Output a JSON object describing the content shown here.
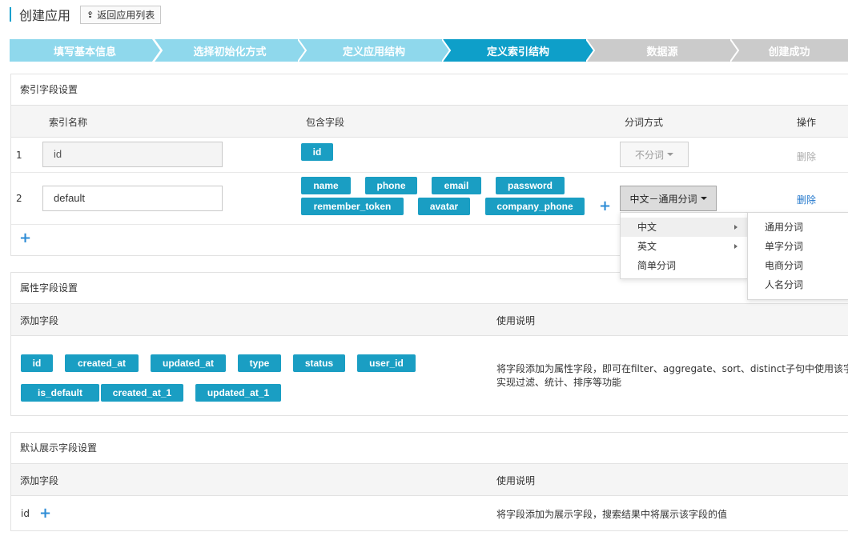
{
  "header": {
    "title": "创建应用",
    "back_label": "返回应用列表"
  },
  "steps": [
    "填写基本信息",
    "选择初始化方式",
    "定义应用结构",
    "定义索引结构",
    "数据源",
    "创建成功"
  ],
  "colors": {
    "step_done": "#8fd8ec",
    "step_active": "#0e9fc9",
    "step_todo": "#cbcbcb",
    "tag": "#1a9ec3",
    "link": "#2277cc"
  },
  "index_section": {
    "title": "索引字段设置",
    "headers": {
      "name": "索引名称",
      "fields": "包含字段",
      "analyzer": "分词方式",
      "action": "操作"
    },
    "rows": [
      {
        "idx": "1",
        "name": "id",
        "fields": [
          "id"
        ],
        "analyzer": "不分词",
        "action": "删除"
      },
      {
        "idx": "2",
        "name": "default",
        "fields": [
          "name",
          "phone",
          "email",
          "password",
          "remember_token",
          "avatar",
          "company_phone"
        ],
        "analyzer": "中文－通用分词",
        "action": "删除"
      }
    ]
  },
  "analyzer_menu": {
    "items": [
      "中文",
      "英文",
      "简单分词"
    ],
    "submenu": [
      "通用分词",
      "单字分词",
      "电商分词",
      "人名分词"
    ]
  },
  "attr_section": {
    "title": "属性字段设置",
    "headers": {
      "add": "添加字段",
      "desc": "使用说明"
    },
    "fields": [
      "id",
      "created_at",
      "updated_at",
      "type",
      "status",
      "user_id",
      "is_default",
      "created_at_1",
      "updated_at_1"
    ],
    "desc_line1": "将字段添加为属性字段，即可在filter、aggregate、sort、distinct子句中使用该字段，",
    "desc_line2": "实现过滤、统计、排序等功能"
  },
  "display_section": {
    "title": "默认展示字段设置",
    "headers": {
      "add": "添加字段",
      "desc": "使用说明"
    },
    "field": "id",
    "desc": "将字段添加为展示字段，搜索结果中将展示该字段的值"
  }
}
